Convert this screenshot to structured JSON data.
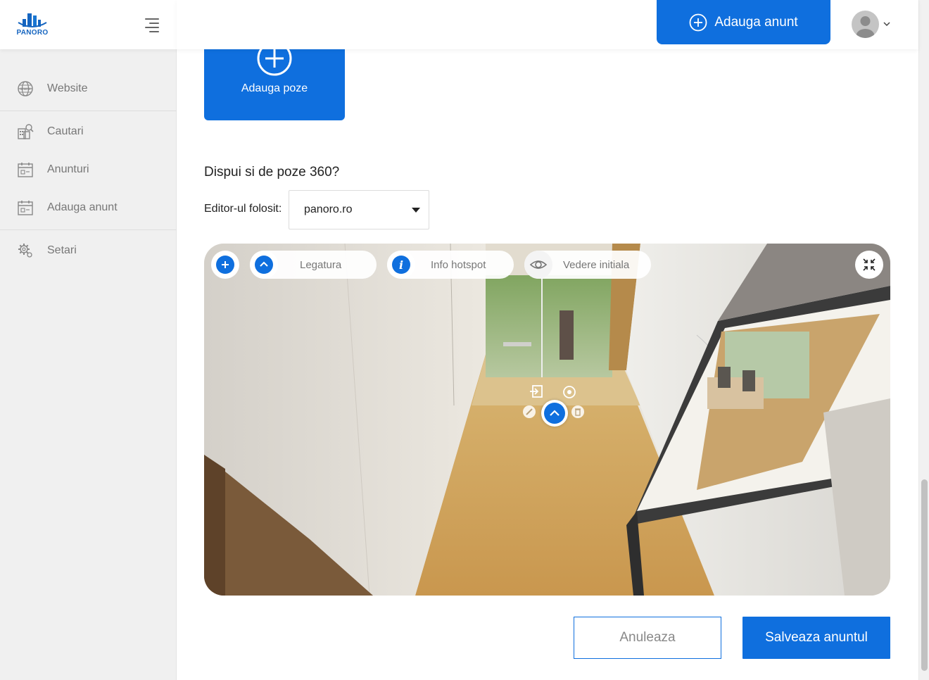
{
  "brand": {
    "name": "PANORO",
    "accent": "#0f6fde"
  },
  "sidebar": {
    "items": [
      {
        "label": "Website",
        "icon": "globe-icon"
      },
      {
        "label": "Cautari",
        "icon": "building-search-icon"
      },
      {
        "label": "Anunturi",
        "icon": "calendar-icon"
      },
      {
        "label": "Adauga anunt",
        "icon": "calendar-add-icon"
      },
      {
        "label": "Setari",
        "icon": "gear-icon"
      }
    ]
  },
  "header": {
    "add_ad_label": "Adauga anunt"
  },
  "main": {
    "add_photos_label": "Adauga poze",
    "question_360": "Dispui si de poze 360?",
    "editor_label": "Editor-ul folosit:",
    "editor_selected": "panoro.ro"
  },
  "viewer": {
    "toolbar": {
      "link_label": "Legatura",
      "info_label": "Info hotspot",
      "initial_view_label": "Vedere initiala"
    }
  },
  "actions": {
    "cancel_label": "Anuleaza",
    "save_label": "Salveaza anuntul"
  }
}
